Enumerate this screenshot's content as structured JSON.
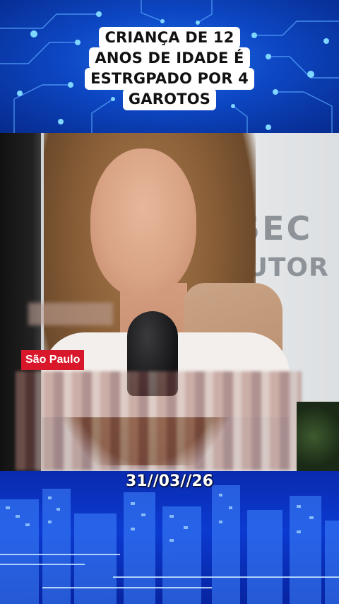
{
  "headline": {
    "lines": [
      "CRIANÇA DE 12",
      "ANOS DE IDADE É",
      "ESTRGPADO POR 4",
      "GAROTOS"
    ]
  },
  "video": {
    "wall_sign_line1": "SEC",
    "wall_sign_line2": "OUTOR",
    "location_label": "São Paulo",
    "location_color": "#d8172a"
  },
  "footer": {
    "date": "31//03//26"
  },
  "colors": {
    "banner_blue": "#0d47c4",
    "headline_bg": "#ffffff",
    "date_text": "#ffffff"
  }
}
